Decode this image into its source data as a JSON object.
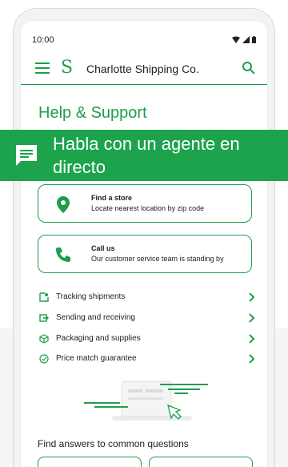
{
  "status_bar": {
    "time": "10:00",
    "icons": [
      "wifi-icon",
      "signal-icon",
      "battery-icon"
    ]
  },
  "app_bar": {
    "title": "Charlotte Shipping Co.",
    "logo_mark": "S"
  },
  "page_title": "Help & Support",
  "banner": {
    "text": "Habla con un agente en directo",
    "icon": "chat-icon"
  },
  "cards": [
    {
      "title": "Find a store",
      "subtitle": "Locate nearest location by zip code",
      "icon": "location-pin-icon"
    },
    {
      "title": "Call us",
      "subtitle": "Our customer service team is standing by",
      "icon": "phone-icon"
    }
  ],
  "help_list": [
    {
      "label": "Tracking shipments",
      "icon": "tracking-icon"
    },
    {
      "label": "Sending and receiving",
      "icon": "send-receive-icon"
    },
    {
      "label": "Packaging and supplies",
      "icon": "package-icon"
    },
    {
      "label": "Price match guarantee",
      "icon": "check-circle-icon"
    }
  ],
  "faq": {
    "title": "Find answers to common questions"
  },
  "colors": {
    "accent": "#1e9e4a",
    "banner": "#1ea34d",
    "text": "#202124"
  }
}
